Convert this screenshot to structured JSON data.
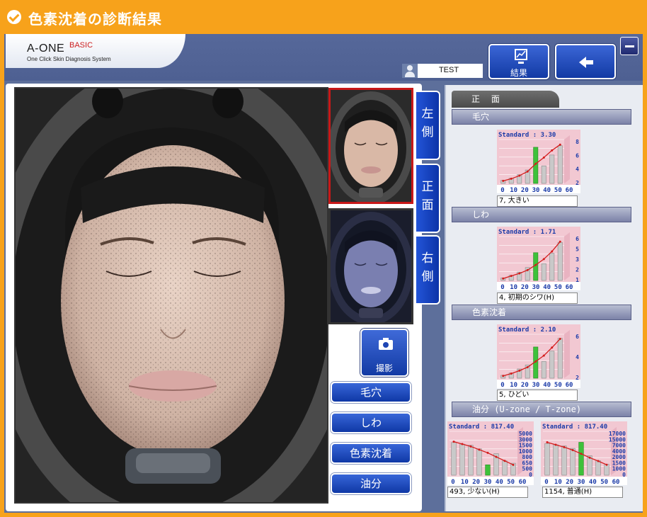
{
  "window": {
    "title": "色素沈着の診断結果"
  },
  "header": {
    "logo_main": "A-ONE",
    "logo_basic": "BASIC",
    "logo_sub": "One Click Skin Diagnosis System",
    "user_name": "TEST",
    "result_button": "結果"
  },
  "side_tabs": [
    "左側",
    "正面",
    "右側"
  ],
  "shoot_button": "撮影",
  "category_buttons": [
    "毛穴",
    "しわ",
    "色素沈着",
    "油分"
  ],
  "panel": {
    "tab_label": "正 面",
    "sections": [
      {
        "title": "毛穴",
        "result": "7, 大きい"
      },
      {
        "title": "しわ",
        "result": "4, 初期のシワ(H)"
      },
      {
        "title": "色素沈着",
        "result": "5, ひどい"
      },
      {
        "title": "油分 (U-zone / T-zone)",
        "results": [
          "493, 少ない(H)",
          "1154, 普通(H)"
        ]
      }
    ]
  },
  "chart_data": [
    {
      "type": "bar",
      "title": "Standard : 3.30",
      "xticks": [
        "0",
        "10",
        "20",
        "30",
        "40",
        "50",
        "60"
      ],
      "yticks": [
        "8",
        "6",
        "4",
        "2"
      ],
      "ylim": [
        0,
        8.5
      ],
      "values": [
        0.6,
        1.0,
        1.7,
        2.6,
        7.0,
        3.4,
        5.5,
        7.3
      ],
      "highlight_index": 4,
      "trend": [
        0.5,
        0.9,
        1.5,
        2.3,
        3.8,
        5.0,
        6.4,
        7.5
      ]
    },
    {
      "type": "bar",
      "title": "Standard : 1.71",
      "xticks": [
        "0",
        "10",
        "20",
        "30",
        "40",
        "50",
        "60"
      ],
      "yticks": [
        "6",
        "5",
        "3",
        "2",
        "1"
      ],
      "ylim": [
        0,
        6.8
      ],
      "values": [
        0.4,
        0.8,
        1.3,
        2.0,
        4.3,
        2.6,
        4.2,
        5.9
      ],
      "highlight_index": 4,
      "trend": [
        0.3,
        0.7,
        1.1,
        1.6,
        2.4,
        3.3,
        4.5,
        6.0
      ]
    },
    {
      "type": "bar",
      "title": "Standard : 2.10",
      "xticks": [
        "0",
        "10",
        "20",
        "30",
        "40",
        "50",
        "60"
      ],
      "yticks": [
        "6",
        "4",
        "2"
      ],
      "ylim": [
        0,
        7.6
      ],
      "values": [
        0.5,
        0.9,
        1.6,
        2.3,
        5.4,
        2.9,
        4.7,
        6.9
      ],
      "highlight_index": 4,
      "trend": [
        0.4,
        0.8,
        1.3,
        1.9,
        2.9,
        3.9,
        5.3,
        6.8
      ]
    },
    {
      "type": "bar",
      "title": "Standard : 817.40",
      "xticks": [
        "0",
        "10",
        "20",
        "30",
        "40",
        "50",
        "60"
      ],
      "yticks": [
        "5000",
        "3000",
        "1500",
        "1000",
        "800",
        "650",
        "500",
        "0"
      ],
      "ylim": [
        0,
        5500
      ],
      "values": [
        4100,
        3900,
        3750,
        3300,
        1300,
        2700,
        1800,
        1500
      ],
      "highlight_index": 4,
      "trend": [
        4200,
        3900,
        3600,
        3200,
        2800,
        2300,
        1800,
        1300
      ]
    },
    {
      "type": "bar",
      "title": "Standard : 817.40",
      "xticks": [
        "0",
        "10",
        "20",
        "30",
        "40",
        "50",
        "60"
      ],
      "yticks": [
        "17000",
        "15000",
        "7000",
        "4000",
        "2000",
        "1500",
        "1000",
        "0"
      ],
      "ylim": [
        0,
        18000
      ],
      "values": [
        13000,
        12500,
        12000,
        11000,
        13500,
        8000,
        6000,
        4500
      ],
      "highlight_index": 4,
      "trend": [
        13500,
        12500,
        11500,
        10300,
        8800,
        7200,
        5800,
        4300
      ]
    }
  ],
  "colors": {
    "accent_orange": "#f7a21b",
    "button_blue": "#1d45b4",
    "highlight_green": "#3ec13a"
  }
}
